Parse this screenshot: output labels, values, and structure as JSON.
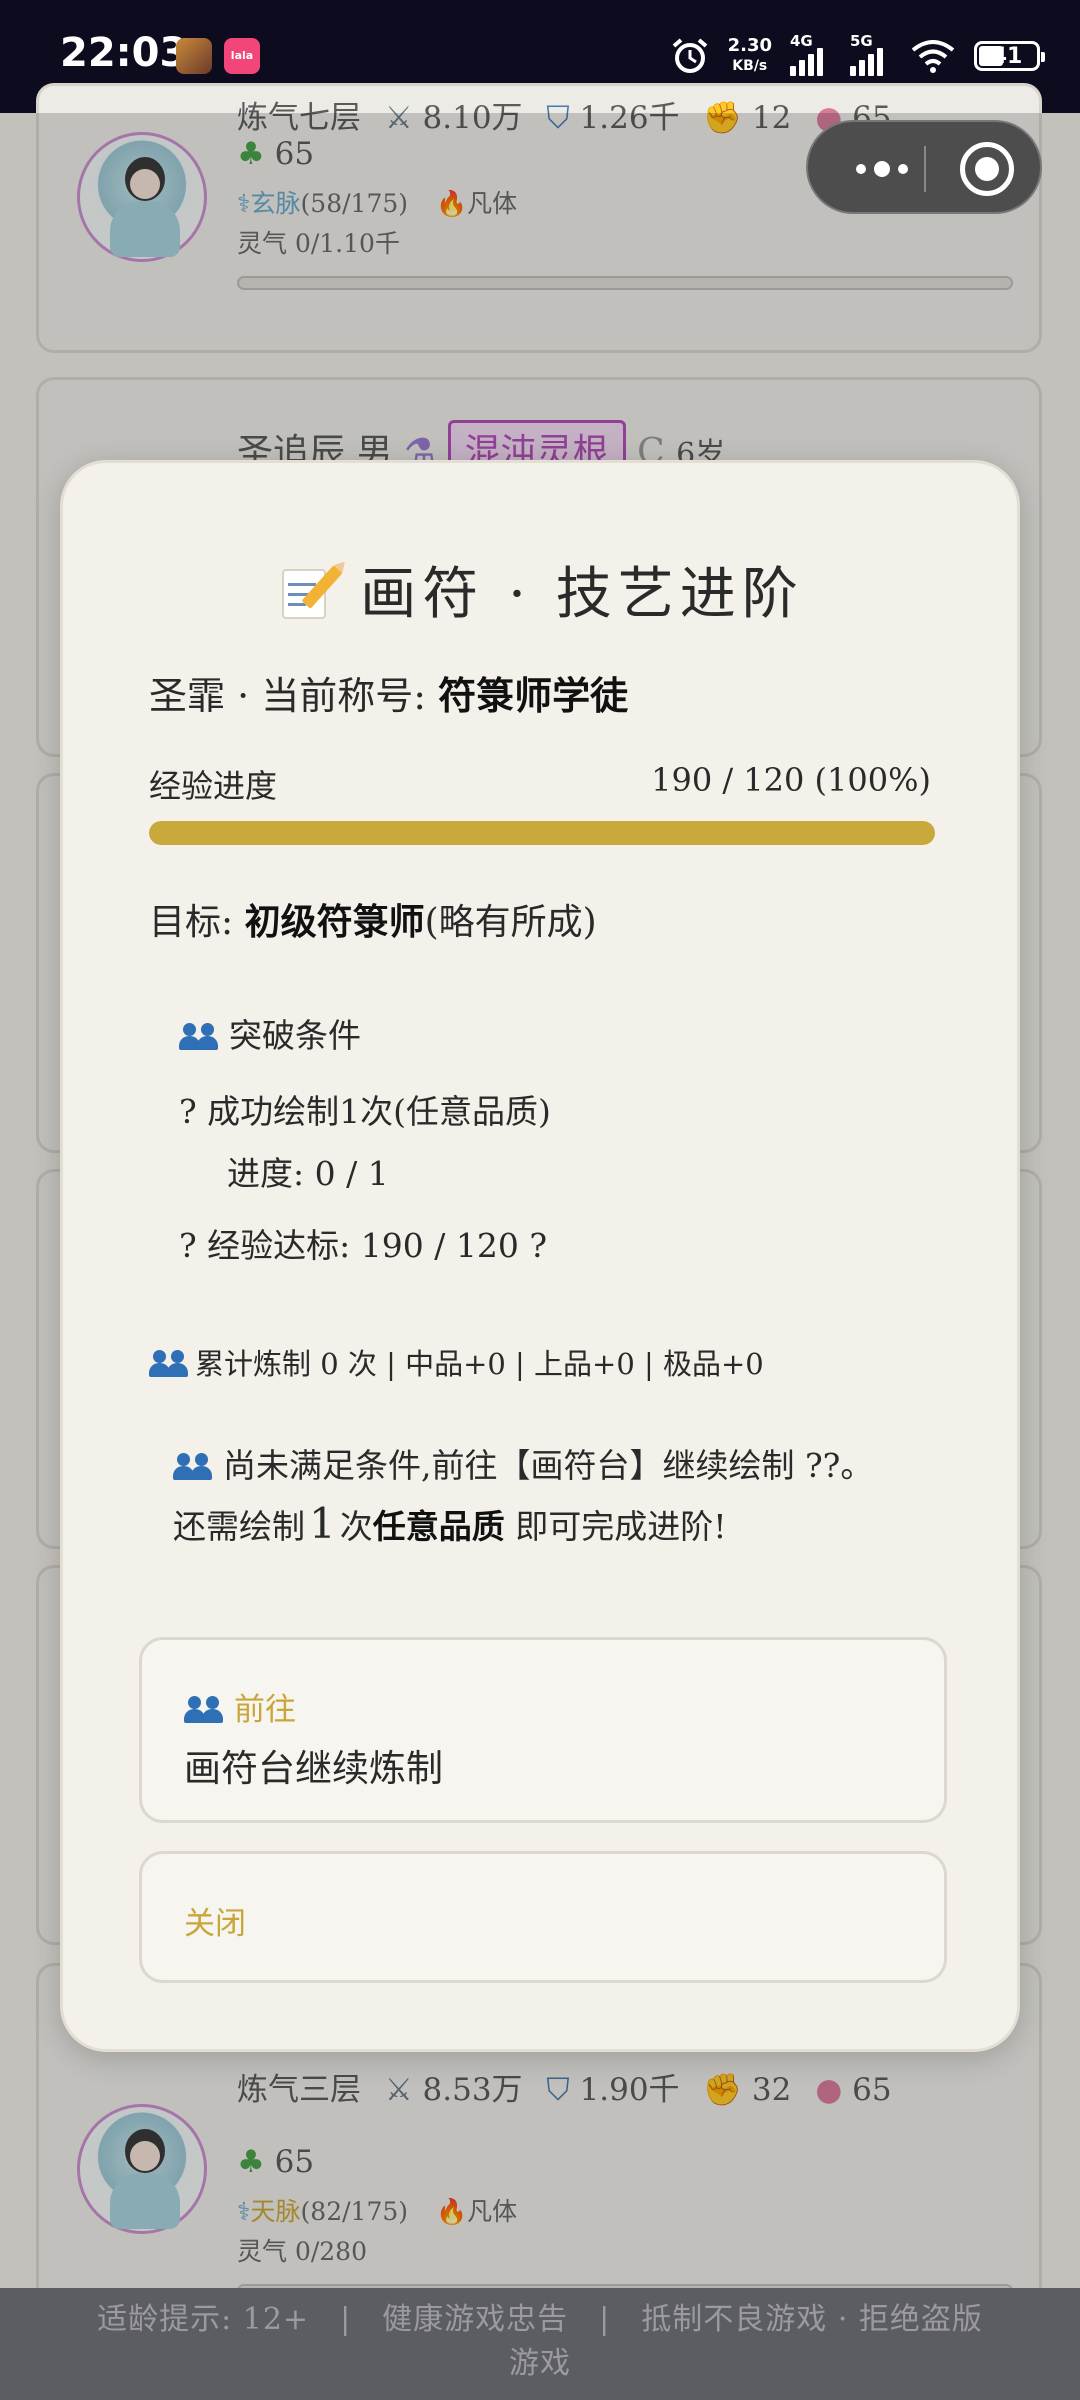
{
  "status_bar": {
    "time": "22:03",
    "app2_label": "lala",
    "speed_top": "2.30",
    "speed_bottom": "KB/s",
    "net1": "4G",
    "net2": "5G",
    "battery": "41"
  },
  "background": {
    "card_top": {
      "realm": "炼气七层",
      "attack": "8.10万",
      "defense": "1.26千",
      "strength": "12",
      "wisdom": "65",
      "luck": "65",
      "vein_name": "玄脉",
      "vein_progress": "(58/175)",
      "body": "凡体",
      "spirit": "灵气 0/1.10千"
    },
    "card_mid": {
      "name": "圣追辰 男",
      "root_tag": "混沌灵根",
      "age": "6岁"
    },
    "card_bottom": {
      "realm": "炼气三层",
      "attack": "8.53万",
      "defense": "1.90千",
      "strength": "32",
      "wisdom": "65",
      "luck": "65",
      "vein_name": "天脉",
      "vein_progress": "(82/175)",
      "body": "凡体",
      "spirit": "灵气 0/280"
    }
  },
  "modal": {
    "title": "画符 · 技艺进阶",
    "rank_prefix": "圣霏 · 当前称号:",
    "rank_title": "符箓师学徒",
    "exp_label": "经验进度",
    "exp_value": "190 / 120 (100%)",
    "exp_progress": 1.0,
    "target_prefix": "目标:",
    "target_rank": "初级符箓师",
    "target_suffix": "(略有所成)",
    "conditions_title": "突破条件",
    "condition1": "? 成功绘制1次(任意品质)",
    "condition1_progress": "进度: 0 / 1",
    "condition2": "? 经验达标: 190 / 120 ?",
    "stats": "累计炼制 0 次 | 中品+0 | 上品+0 | 极品+0",
    "notice_line1": "尚未满足条件,前往【画符台】继续绘制 ??。",
    "notice_prefix": "还需绘制",
    "notice_count": "1",
    "notice_mid": "次",
    "notice_quality": "任意品质",
    "notice_suffix": "即可完成进阶!",
    "go_label": "前往",
    "go_desc": "画符台继续炼制",
    "close_label": "关闭"
  },
  "footer": {
    "line1": "适龄提示: 12+　|　健康游戏忠告　|　抵制不良游戏 · 拒绝盗版",
    "line2": "游戏"
  },
  "colors": {
    "accent_gold": "#c9a93c",
    "link_blue": "#6aa9c7",
    "tag_purple": "#b04fb6",
    "icon_blue": "#2f6fb5"
  }
}
